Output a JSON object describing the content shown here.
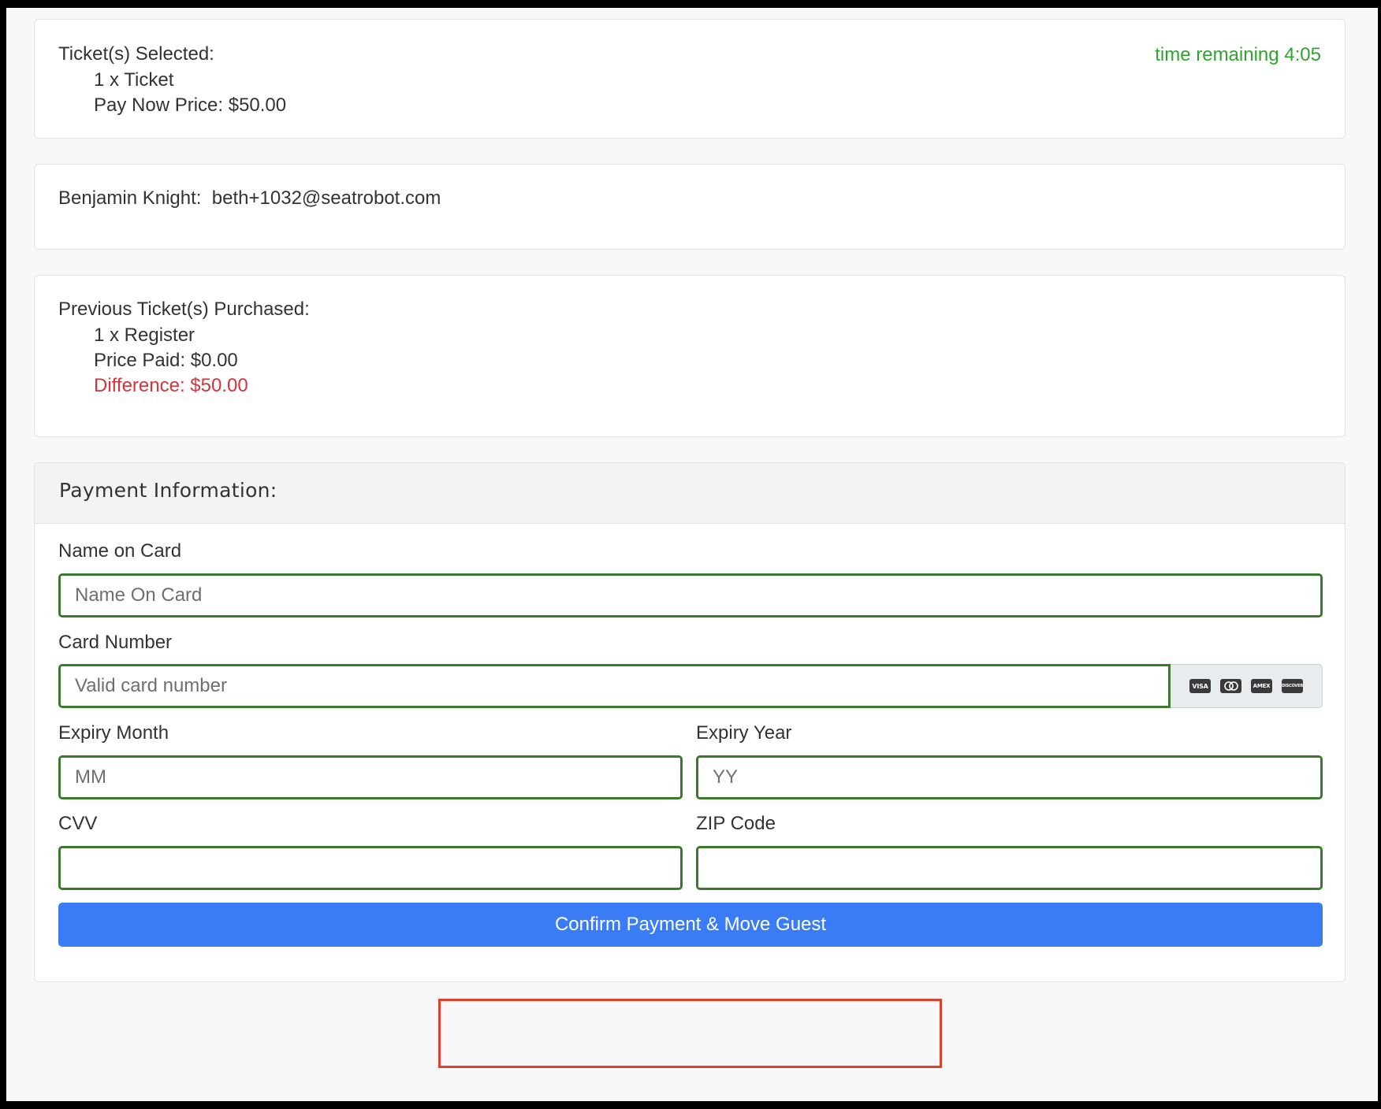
{
  "selected": {
    "heading": "Ticket(s) Selected:",
    "line1": "1 x Ticket",
    "line2": "Pay Now Price: $50.00",
    "timer": "time remaining 4:05"
  },
  "guest": {
    "name": "Benjamin Knight:",
    "email": "beth+1032@seatrobot.com"
  },
  "previous": {
    "heading": "Previous Ticket(s) Purchased:",
    "line1": "1 x Register",
    "line2": "Price Paid: $0.00",
    "difference": "Difference: $50.00"
  },
  "payment": {
    "title": "Payment Information:",
    "name_label": "Name on Card",
    "name_placeholder": "Name On Card",
    "number_label": "Card Number",
    "number_placeholder": "Valid card number",
    "card_brands": [
      "VISA",
      "MC",
      "AMEX",
      "DISCOVER"
    ],
    "month_label": "Expiry Month",
    "month_placeholder": "MM",
    "year_label": "Expiry Year",
    "year_placeholder": "YY",
    "cvv_label": "CVV",
    "zip_label": "ZIP Code",
    "submit_label": "Confirm Payment & Move Guest"
  },
  "colors": {
    "timer": "#2fa52f",
    "difference": "#d8323a",
    "input_border": "#3b7a2e",
    "button": "#3a7cf5",
    "highlight": "#e0412e"
  }
}
